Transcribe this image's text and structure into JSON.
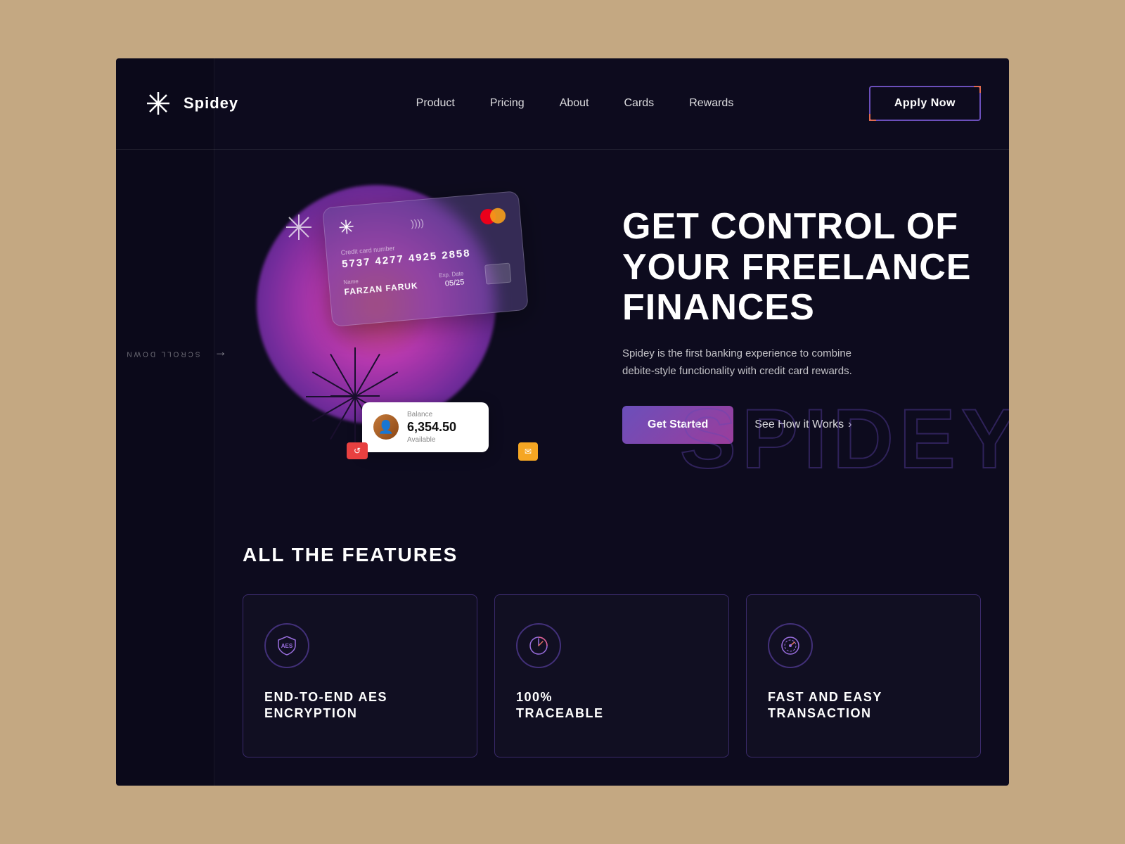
{
  "brand": {
    "name": "Spidey",
    "icon": "✳"
  },
  "navbar": {
    "links": [
      {
        "label": "Product",
        "id": "product"
      },
      {
        "label": "Pricing",
        "id": "pricing"
      },
      {
        "label": "About",
        "id": "about"
      },
      {
        "label": "Cards",
        "id": "cards"
      },
      {
        "label": "Rewards",
        "id": "rewards"
      }
    ],
    "cta": "Apply Now"
  },
  "hero": {
    "title": "GET CONTROL OF YOUR FREELANCE FINANCES",
    "subtitle": "Spidey is the first banking experience to combine debite-style functionality with credit card rewards.",
    "cta_primary": "Get Started",
    "cta_secondary": "See How it Works",
    "cta_secondary_arrow": "›",
    "card": {
      "number_label": "Credit card number",
      "number": "5737 4277 4925 2858",
      "exp_label": "Exp. Date",
      "exp": "05/25",
      "name_label": "Name",
      "name": "FARZAN FARUK"
    },
    "balance": {
      "label": "Balance",
      "amount": "6,354.50",
      "available": "Available"
    },
    "watermark": "SPIDEY"
  },
  "scroll_down": {
    "text": "SCROLL DOWN",
    "arrow": "↓"
  },
  "features": {
    "section_title": "ALL THE FEATURES",
    "items": [
      {
        "id": "encryption",
        "icon": "🛡",
        "label": "END-TO-END AES\nENCRYPTION"
      },
      {
        "id": "traceable",
        "icon": "◷",
        "label": "100%\nTRACEABLE"
      },
      {
        "id": "transaction",
        "icon": "⊙",
        "label": "FAST AND EASY\nTRANSACTION"
      }
    ]
  }
}
